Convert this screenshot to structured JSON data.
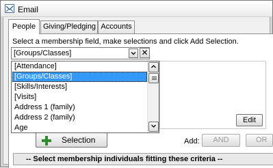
{
  "window": {
    "title": "Email"
  },
  "tabs": [
    {
      "label": "People",
      "active": true
    },
    {
      "label": "Giving/Pledging",
      "active": false
    },
    {
      "label": "Accounts",
      "active": false
    }
  ],
  "membership": {
    "instruction": "Select a membership field, make selections and click Add Selection.",
    "selected_field": "[Groups/Classes]",
    "options": [
      "[Attendance]",
      "[Groups/Classes]",
      "[Skills/Interests]",
      "[Visits]",
      "Address 1 (family)",
      "Address 2 (family)",
      "Age"
    ],
    "highlighted_index": 1
  },
  "buttons": {
    "clear": "✕",
    "edit": "Edit",
    "selection": "Selection",
    "add_label": "Add:",
    "and": "AND",
    "or": "OR"
  },
  "criteria": {
    "header": "-- Select membership individuals fitting these criteria --"
  },
  "colors": {
    "highlight": "#3399ff",
    "add_icon": "#2e8b2e"
  },
  "icons": {
    "title": "email-window-icon",
    "combo_arrow": "chevron-down-icon",
    "scroll_up": "chevron-up-icon",
    "scroll_down": "chevron-down-icon",
    "add": "plus-icon"
  }
}
